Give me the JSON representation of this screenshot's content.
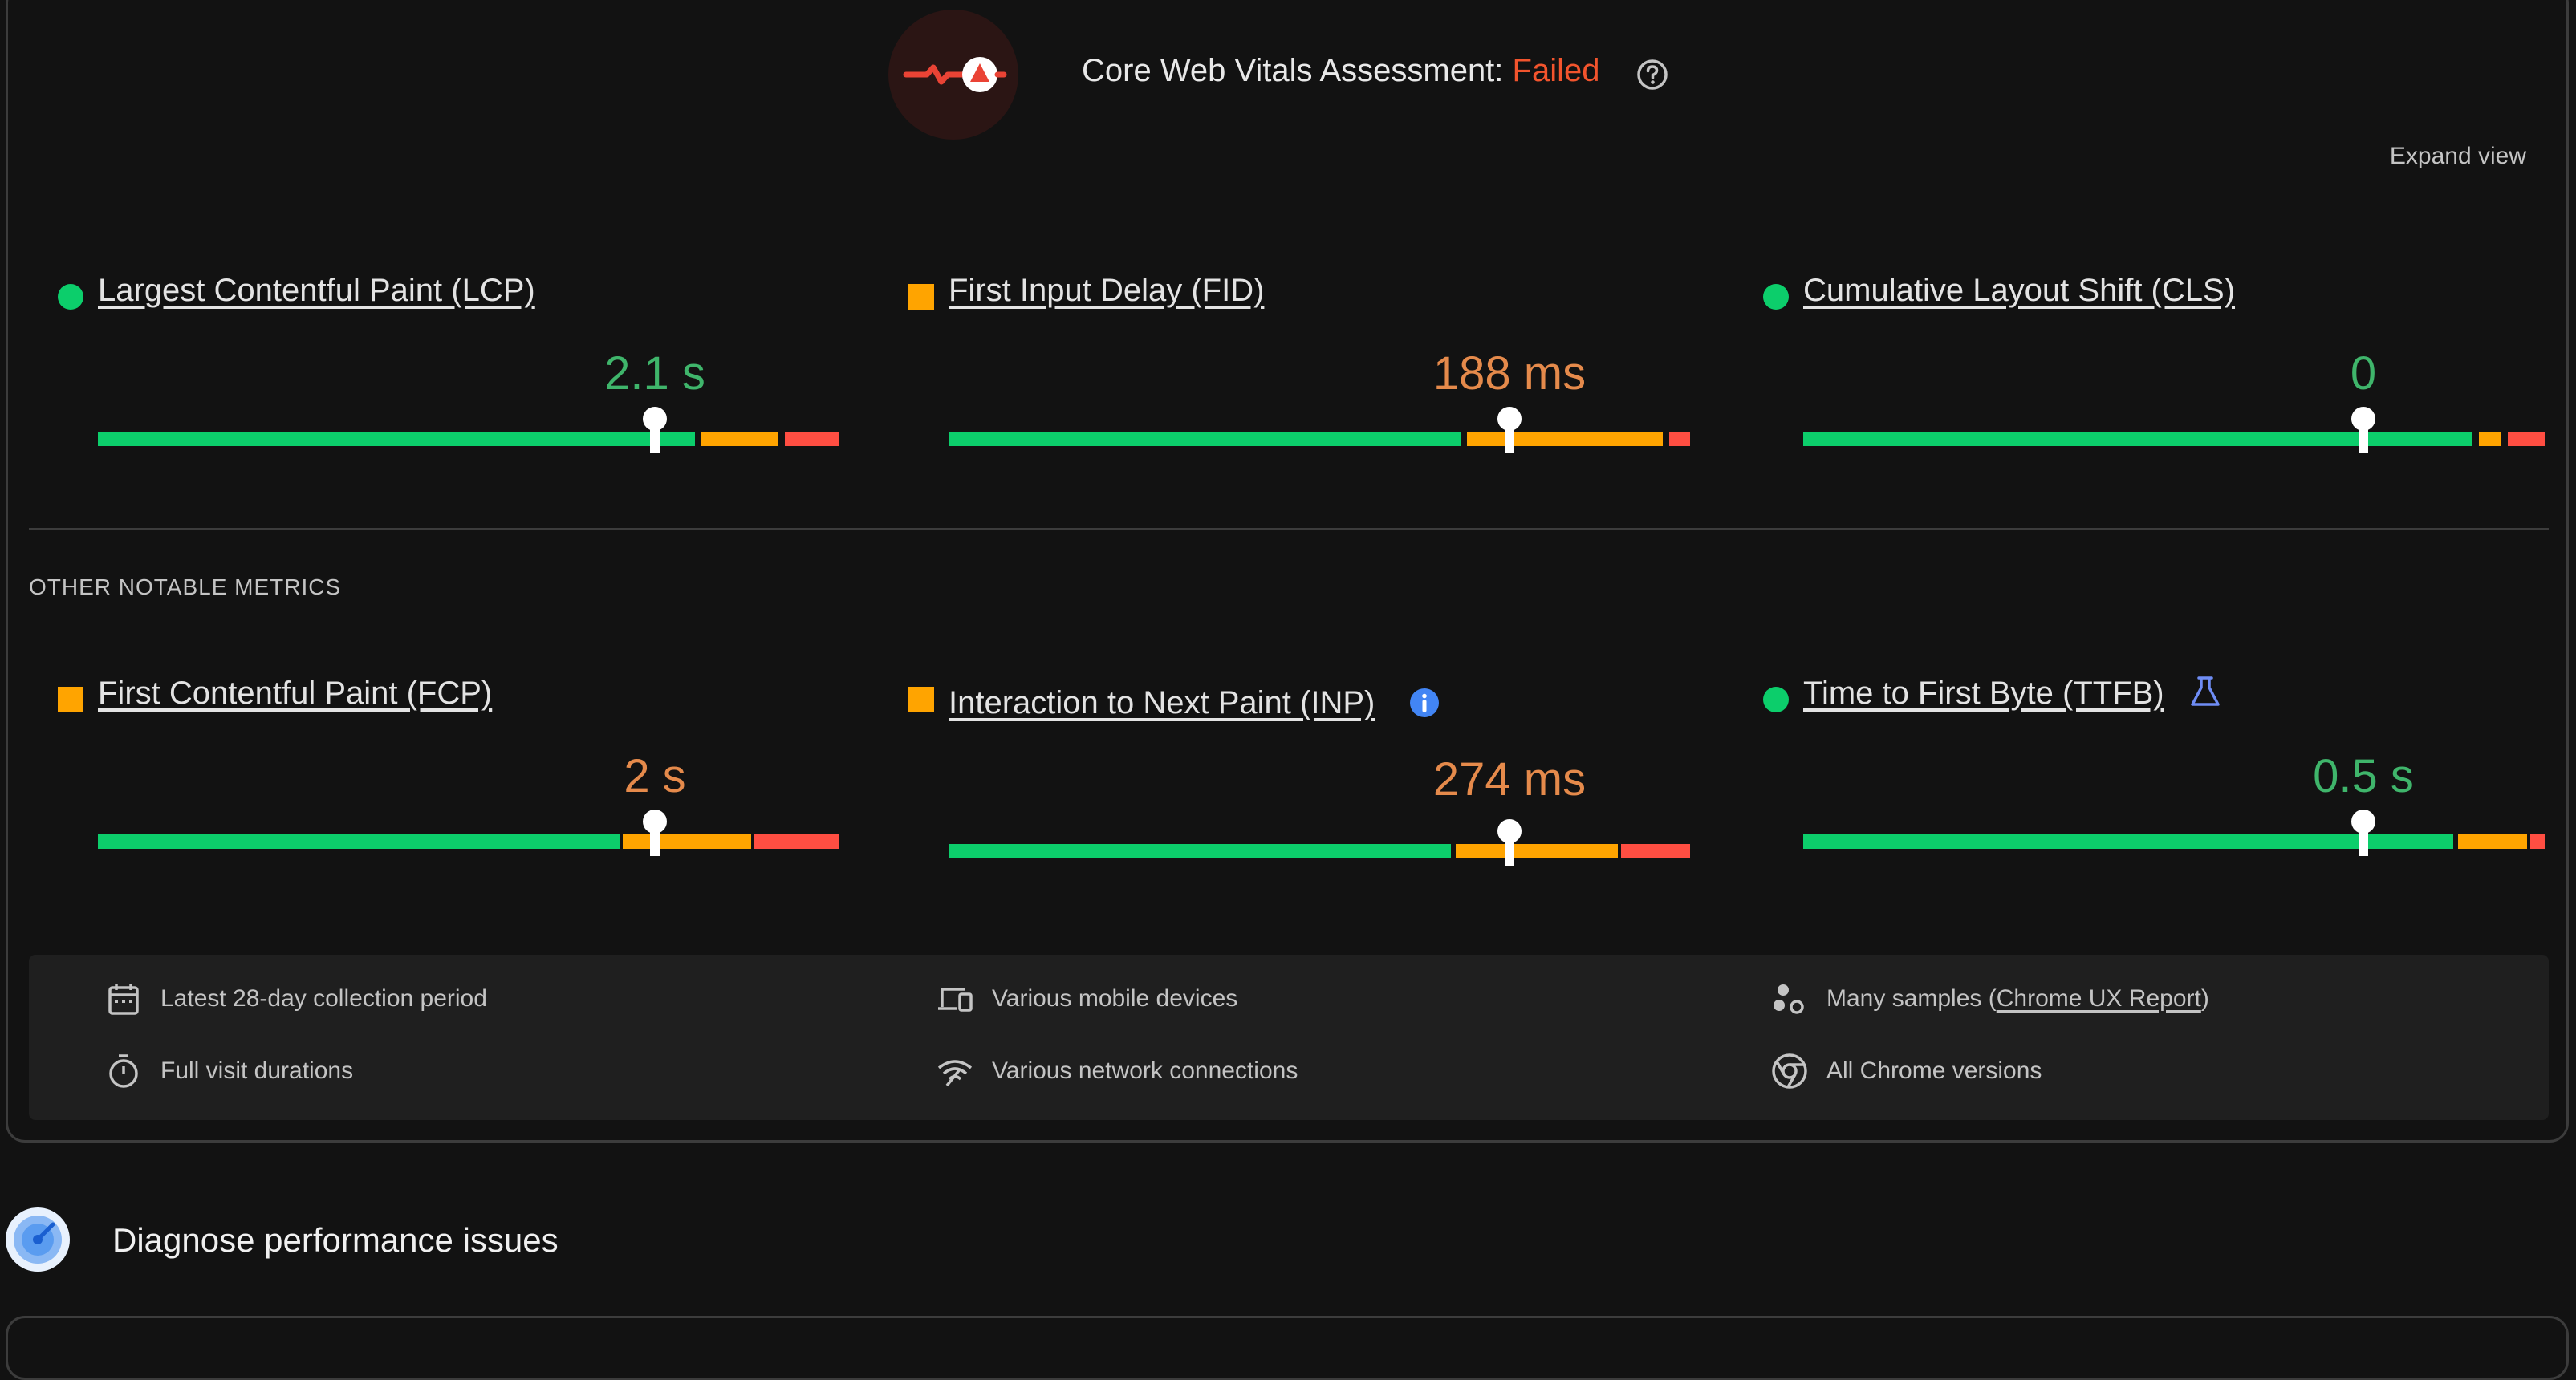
{
  "assessment": {
    "label": "Core Web Vitals Assessment:",
    "status": "Failed",
    "help_icon": "help-circle-icon",
    "badge_icon": "failed-trend-icon",
    "expand_label": "Expand view"
  },
  "colors": {
    "good": "#0cce6b",
    "needs_improvement": "#ffa400",
    "poor": "#ff4e42",
    "failed_text": "#f2542d",
    "info_blue": "#4285f4",
    "lab_blue": "#6f8df5"
  },
  "core_metrics": [
    {
      "name": "Largest Contentful Paint (LCP)",
      "value": "2.1 s",
      "status": "good",
      "marker_position": 0.75
    },
    {
      "name": "First Input Delay (FID)",
      "value": "188 ms",
      "status": "needs-improvement",
      "marker_position": 0.75
    },
    {
      "name": "Cumulative Layout Shift (CLS)",
      "value": "0",
      "status": "good",
      "marker_position": 0.75
    }
  ],
  "other_section_label": "OTHER NOTABLE METRICS",
  "other_metrics": [
    {
      "name": "First Contentful Paint (FCP)",
      "value": "2 s",
      "status": "needs-improvement",
      "marker_position": 0.75
    },
    {
      "name": "Interaction to Next Paint (INP)",
      "value": "274 ms",
      "status": "needs-improvement",
      "marker_position": 0.75,
      "extra_icon": "info-icon"
    },
    {
      "name": "Time to First Byte (TTFB)",
      "value": "0.5 s",
      "status": "good",
      "marker_position": 0.75,
      "extra_icon": "lab-flask-icon"
    }
  ],
  "footer": {
    "collection_period": "Latest 28-day collection period",
    "devices": "Various mobile devices",
    "samples_prefix": "Many samples (",
    "samples_link": "Chrome UX Report",
    "samples_suffix": ")",
    "durations": "Full visit durations",
    "network": "Various network connections",
    "chrome_versions": "All Chrome versions",
    "icons": [
      "calendar-icon",
      "devices-icon",
      "samples-icon",
      "stopwatch-icon",
      "network-signal-icon",
      "chrome-icon"
    ]
  },
  "diagnose": {
    "title": "Diagnose performance issues",
    "icon": "lighthouse-gauge-icon"
  }
}
